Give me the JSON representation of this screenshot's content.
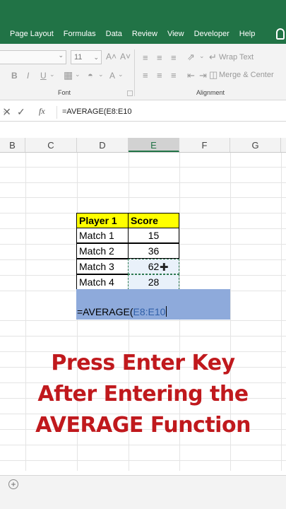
{
  "ribbon_tabs": [
    "Page Layout",
    "Formulas",
    "Data",
    "Review",
    "View",
    "Developer",
    "Help"
  ],
  "ribbon": {
    "font_size": "11",
    "font_group_label": "Font",
    "alignment_group_label": "Alignment",
    "wrap_text": "Wrap Text",
    "merge_center": "Merge & Center",
    "grow_font": "A˄",
    "shrink_font": "A˅",
    "bold": "B",
    "italic": "I",
    "underline": "U"
  },
  "formula_bar": {
    "fx": "fx",
    "value": "=AVERAGE(E8:E10"
  },
  "columns": [
    {
      "label": "B"
    },
    {
      "label": "C"
    },
    {
      "label": "D"
    },
    {
      "label": "E",
      "active": true
    },
    {
      "label": "F"
    },
    {
      "label": "G"
    }
  ],
  "table": {
    "header": [
      "Player 1",
      "Score"
    ],
    "rows": [
      [
        "Match 1",
        "15"
      ],
      [
        "Match 2",
        "36"
      ],
      [
        "Match 3",
        "62"
      ],
      [
        "Match 4",
        "28"
      ]
    ]
  },
  "editing_cell": {
    "prefix": "=AVERAGE(",
    "reference": "E8:E10"
  },
  "caption": [
    "Press Enter Key",
    "After Entering the",
    "AVERAGE Function"
  ],
  "colors": {
    "excel_green": "#217346",
    "header_yellow": "#ffff00",
    "caption_red": "#c0191d",
    "edit_fill": "#8eaadb"
  }
}
